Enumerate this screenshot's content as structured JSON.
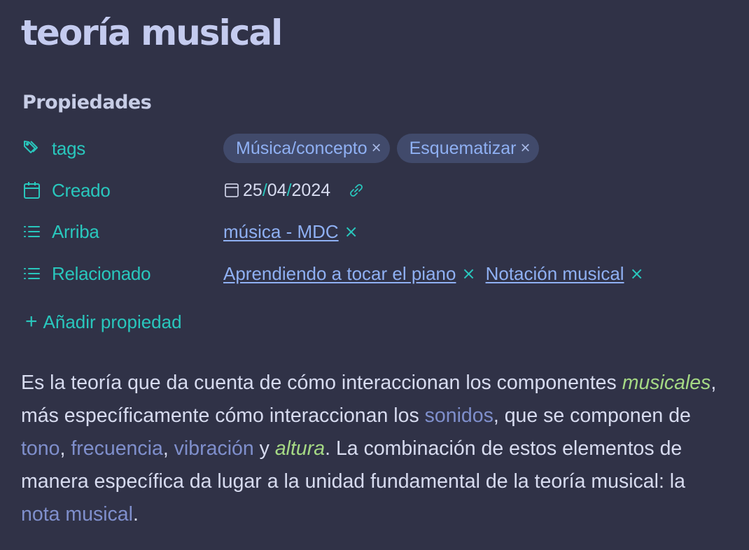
{
  "note": {
    "title": "teoría musical",
    "properties_heading": "Propiedades"
  },
  "properties": {
    "tags": {
      "label": "tags",
      "icon": "tags-icon",
      "values": [
        "Música/concepto",
        "Esquematizar"
      ]
    },
    "created": {
      "label": "Creado",
      "icon": "calendar-icon",
      "day": "25",
      "month": "04",
      "year": "2024",
      "separator": "/"
    },
    "arriba": {
      "label": "Arriba",
      "icon": "list-icon",
      "links": [
        "música - MDC"
      ]
    },
    "relacionado": {
      "label": "Relacionado",
      "icon": "list-icon",
      "links": [
        "Aprendiendo a tocar el piano",
        "Notación musical"
      ]
    },
    "add_property": "Añadir propiedad",
    "remove_symbol": "×",
    "add_symbol": "+"
  },
  "content": {
    "p1": "Es la teoría que da cuenta de cómo interaccionan los componentes ",
    "w_musicales": "musicales",
    "p2": ", más específicamente cómo interaccionan los ",
    "l_sonidos": "sonidos",
    "p3": ", que se componen de ",
    "l_tono": "tono",
    "c1": ", ",
    "l_frecuencia": "frecuencia",
    "c2": ", ",
    "l_vibracion": "vibración",
    "p4": " y ",
    "w_altura": "altura",
    "p5": ". La combinación de estos elementos de manera específica da lugar a la unidad fundamental de la teoría musical: la ",
    "l_nota": "nota musical",
    "p6": "."
  },
  "colors": {
    "background": "#303247",
    "accent": "#29c7bd",
    "link": "#8fb0f3",
    "italic_green": "#a5d984",
    "text": "#d7dbef"
  }
}
